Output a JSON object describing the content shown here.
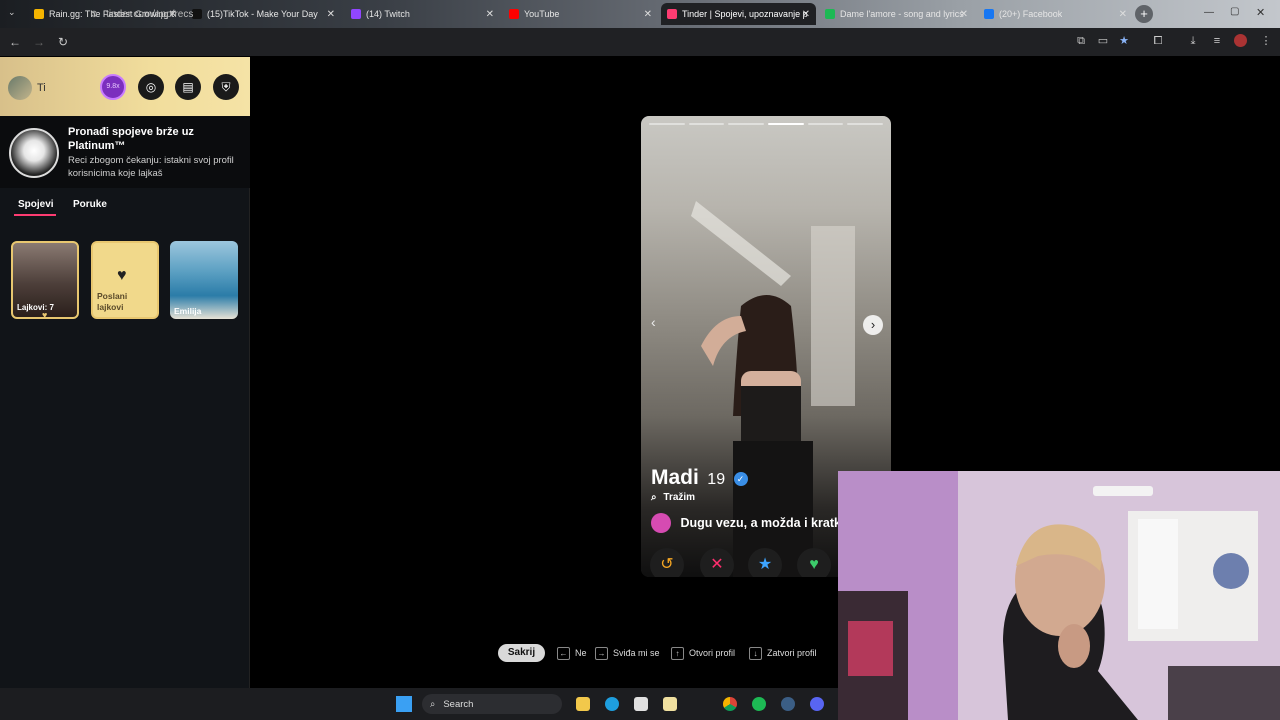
{
  "browser": {
    "tabs": [
      {
        "title": "Rain.gg: The Fastest Growing C",
        "color": "#f4b400",
        "active": false
      },
      {
        "title": "(15)TikTok - Make Your Day",
        "color": "#111111",
        "active": false
      },
      {
        "title": "(14) Twitch",
        "color": "#9146ff",
        "active": false
      },
      {
        "title": "YouTube",
        "color": "#ff0000",
        "active": false
      },
      {
        "title": "Tinder | Spojevi, upoznavanje p",
        "color": "#fe3c72",
        "active": true
      },
      {
        "title": "Dame l'amore - song and lyrics",
        "color": "#1db954",
        "active": false
      },
      {
        "title": "(20+) Facebook",
        "color": "#1877f2",
        "active": false
      }
    ],
    "url": "tinder.com/app/recs"
  },
  "sidebar": {
    "profile_label": "Ti",
    "boost_label": "9.8x",
    "promo": {
      "title": "Pronađi spojeve brže uz Platinum™",
      "subtitle": "Reci zbogom čekanju: istakni svoj profil korisnicima koje lajkaš"
    },
    "tabs": [
      {
        "label": "Spojevi",
        "active": true
      },
      {
        "label": "Poruke",
        "active": false
      }
    ],
    "cards": [
      {
        "label": "Lajkovi: 7"
      },
      {
        "label": "Poslani lajkovi"
      },
      {
        "label": "Emilija"
      }
    ]
  },
  "card": {
    "name": "Madi",
    "age": "19",
    "looking_label": "Tražim",
    "relationship_goal": "Dugu vezu, a možda i kratku",
    "photo_count": 6,
    "active_photo": 4
  },
  "hints": {
    "hide": "Sakrij",
    "no": "Ne",
    "like": "Sviđa mi se",
    "open": "Otvori profil",
    "close": "Zatvori profil"
  },
  "taskbar": {
    "search_label": "Search"
  }
}
